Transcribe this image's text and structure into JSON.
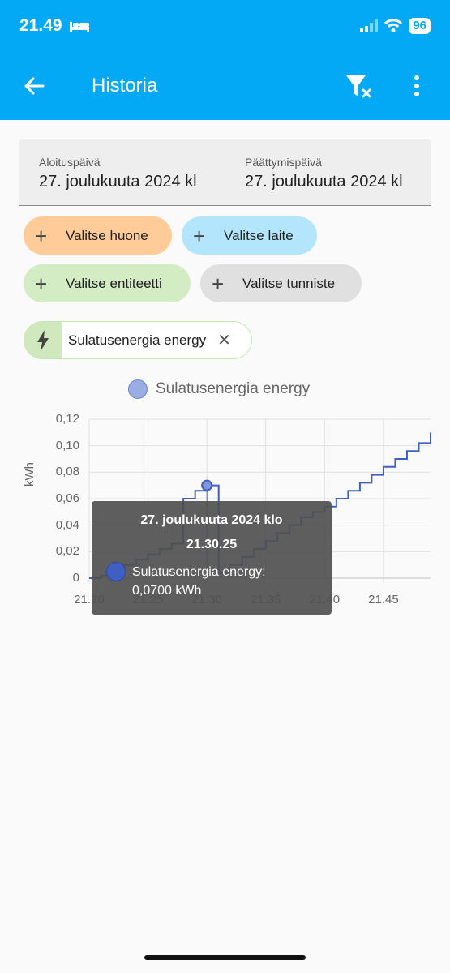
{
  "status_bar": {
    "time": "21.49",
    "battery": "96"
  },
  "app_bar": {
    "title": "Historia",
    "back_icon": "arrow-left-icon",
    "filter_icon": "filter-remove-icon",
    "menu_icon": "dots-vertical-icon"
  },
  "date_range": {
    "start_label": "Aloituspäivä",
    "start_value": "27. joulukuuta 2024 kl",
    "end_label": "Päättymispäivä",
    "end_value": "27. joulukuuta 2024 kl"
  },
  "target_chips": {
    "room": "Valitse huone",
    "device": "Valitse laite",
    "entity": "Valitse entiteetti",
    "tag": "Valitse tunniste"
  },
  "selected_entity": {
    "label": "Sulatusenergia energy",
    "icon": "lightning-bolt-icon"
  },
  "colors": {
    "accent": "#03a9f4",
    "series": "#3f5fc4",
    "room": "#ffcc99",
    "device": "#b3e5fc",
    "entity": "#d4ecc4",
    "tag": "#e0e0e0"
  },
  "chart_data": {
    "type": "line",
    "ylabel": "kWh",
    "ylim": [
      0,
      0.12
    ],
    "xlim": [
      "21.20",
      "21.49"
    ],
    "y_ticks": [
      "0,12",
      "0,10",
      "0,08",
      "0,06",
      "0,04",
      "0,02",
      "0"
    ],
    "x_ticks": [
      "21.20",
      "21.25",
      "21.30",
      "21.35",
      "21.40",
      "21.45"
    ],
    "grid": true,
    "legend": "top-center",
    "series": [
      {
        "name": "Sulatusenergia energy",
        "points": [
          [
            "21.20",
            0.0
          ],
          [
            "21.21",
            0.002
          ],
          [
            "21.22",
            0.006
          ],
          [
            "21.23",
            0.01
          ],
          [
            "21.24",
            0.014
          ],
          [
            "21.25",
            0.018
          ],
          [
            "21.26",
            0.022
          ],
          [
            "21.27",
            0.026
          ],
          [
            "21.28",
            0.06
          ],
          [
            "21.29",
            0.066
          ],
          [
            "21.30",
            0.07
          ],
          [
            "21.31",
            0.004
          ],
          [
            "21.32",
            0.01
          ],
          [
            "21.33",
            0.016
          ],
          [
            "21.34",
            0.022
          ],
          [
            "21.35",
            0.028
          ],
          [
            "21.36",
            0.034
          ],
          [
            "21.37",
            0.04
          ],
          [
            "21.38",
            0.046
          ],
          [
            "21.39",
            0.05
          ],
          [
            "21.40",
            0.054
          ],
          [
            "21.41",
            0.06
          ],
          [
            "21.42",
            0.066
          ],
          [
            "21.43",
            0.072
          ],
          [
            "21.44",
            0.078
          ],
          [
            "21.45",
            0.084
          ],
          [
            "21.46",
            0.09
          ],
          [
            "21.47",
            0.096
          ],
          [
            "21.48",
            0.102
          ],
          [
            "21.49",
            0.11
          ]
        ]
      }
    ],
    "tooltip": {
      "date": "27. joulukuuta 2024 klo",
      "time": "21.30.25",
      "series_label": "Sulatusenergia energy:",
      "value_label": "0,0700 kWh"
    }
  }
}
